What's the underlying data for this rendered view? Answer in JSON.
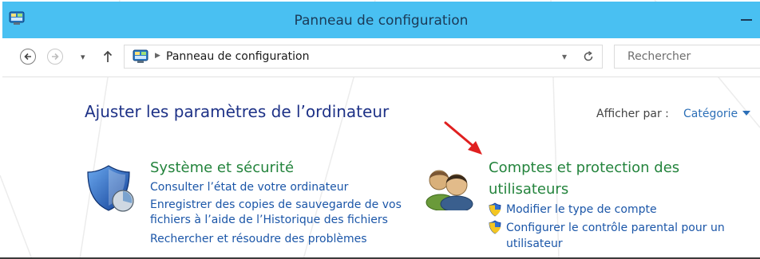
{
  "window": {
    "title": "Panneau de configuration"
  },
  "address": {
    "crumb": "Panneau de configuration"
  },
  "search": {
    "placeholder": "Rechercher"
  },
  "main": {
    "heading": "Ajuster les paramètres de l’ordinateur",
    "view_by_label": "Afficher par :",
    "view_by_value": "Catégorie"
  },
  "categories": [
    {
      "title": "Système et sécurité",
      "icon": "security-shield-icon",
      "links": [
        "Consulter l’état de votre ordinateur",
        "Enregistrer des copies de sauvegarde de vos",
        "fichiers à l’aide de l’Historique des fichiers",
        "Rechercher et résoudre des problèmes"
      ]
    },
    {
      "title_line1": "Comptes et protection des",
      "title_line2": "utilisateurs",
      "icon": "users-icon",
      "links": [
        "Modifier le type de compte",
        "Configurer le contrôle parental pour un",
        "utilisateur"
      ]
    }
  ],
  "colors": {
    "titlebar": "#49c0f2",
    "category_title": "#24843d",
    "link": "#1b56a8",
    "heading": "#1e3287",
    "annotation_arrow": "#e02020"
  }
}
